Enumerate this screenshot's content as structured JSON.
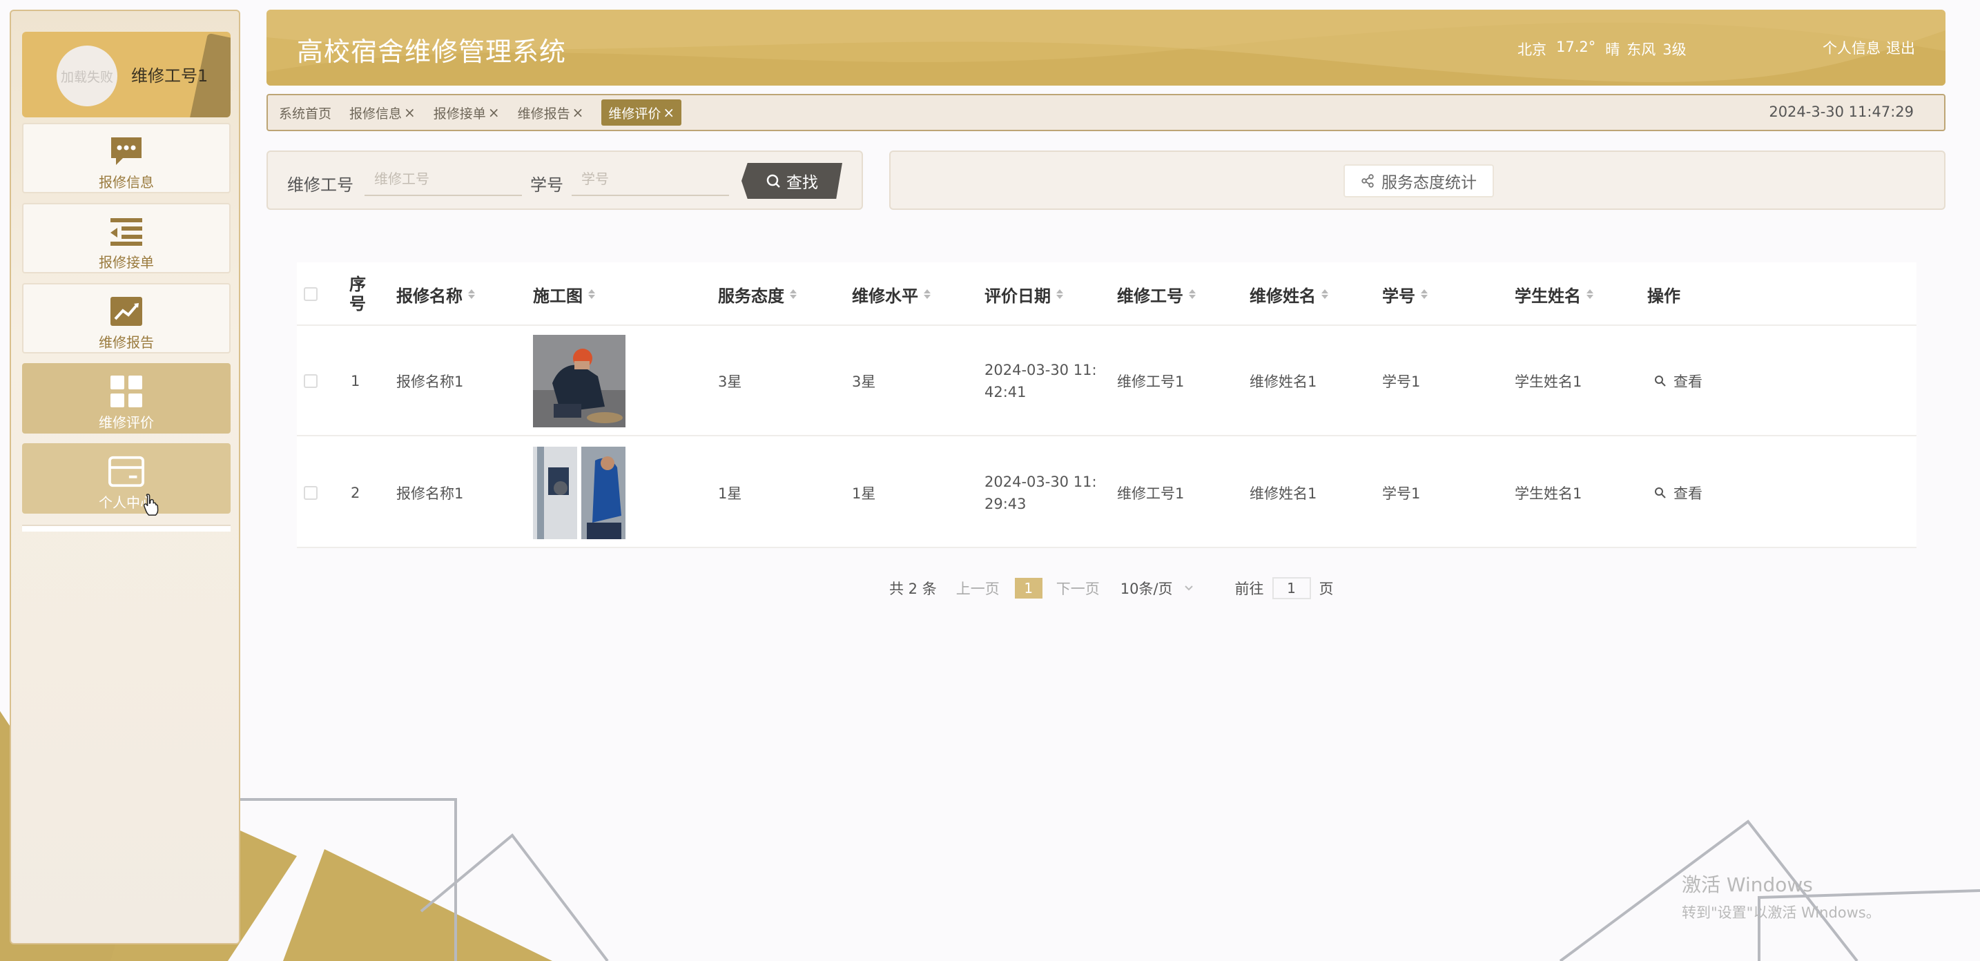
{
  "header": {
    "title": "高校宿舍维修管理系统",
    "weather": {
      "city": "北京",
      "temp": "17.2°",
      "condition": "晴",
      "wind": "东风",
      "level": "3级"
    },
    "profile_link": "个人信息",
    "logout_link": "退出"
  },
  "sidebar": {
    "avatar_text": "加载失败",
    "user_name": "维修工号1",
    "items": [
      {
        "label": "报修信息",
        "icon": "message-dots-icon"
      },
      {
        "label": "报修接单",
        "icon": "list-indent-icon"
      },
      {
        "label": "维修报告",
        "icon": "trend-chart-icon"
      },
      {
        "label": "维修评价",
        "icon": "grid-icon"
      },
      {
        "label": "个人中心",
        "icon": "card-icon"
      }
    ]
  },
  "tabs": {
    "items": [
      {
        "label": "系统首页",
        "closable": false
      },
      {
        "label": "报修信息",
        "closable": true
      },
      {
        "label": "报修接单",
        "closable": true
      },
      {
        "label": "维修报告",
        "closable": true
      },
      {
        "label": "维修评价",
        "closable": true
      }
    ],
    "close_glyph": "×",
    "datetime": "2024-3-30 11:47:29"
  },
  "search": {
    "worker_label": "维修工号",
    "worker_placeholder": "维修工号",
    "student_label": "学号",
    "student_placeholder": "学号",
    "button_label": "查找"
  },
  "stats": {
    "button_label": "服务态度统计"
  },
  "table": {
    "headers": [
      "序号",
      "报修名称",
      "施工图",
      "服务态度",
      "维修水平",
      "评价日期",
      "维修工号",
      "维修姓名",
      "学号",
      "学生姓名",
      "操作"
    ],
    "rows": [
      {
        "index": "1",
        "name": "报修名称1",
        "attitude": "3星",
        "level": "3星",
        "date_line1": "2024-03-30 11:",
        "date_line2": "42:41",
        "worker_id": "维修工号1",
        "worker_name": "维修姓名1",
        "student_id": "学号1",
        "student_name": "学生姓名1",
        "action": "查看"
      },
      {
        "index": "2",
        "name": "报修名称1",
        "attitude": "1星",
        "level": "1星",
        "date_line1": "2024-03-30 11:",
        "date_line2": "29:43",
        "worker_id": "维修工号1",
        "worker_name": "维修姓名1",
        "student_id": "学号1",
        "student_name": "学生姓名1",
        "action": "查看"
      }
    ]
  },
  "pagination": {
    "total": "共 2 条",
    "prev": "上一页",
    "current": "1",
    "next": "下一页",
    "page_size": "10条/页",
    "goto_label": "前往",
    "goto_value": "1",
    "page_suffix": "页"
  },
  "watermark": {
    "line1": "激活 Windows",
    "line2": "转到\"设置\"以激活 Windows。"
  },
  "colors": {
    "accent": "#d7b766",
    "dark_accent": "#9f8541",
    "menu_active": "#d7c08c"
  }
}
